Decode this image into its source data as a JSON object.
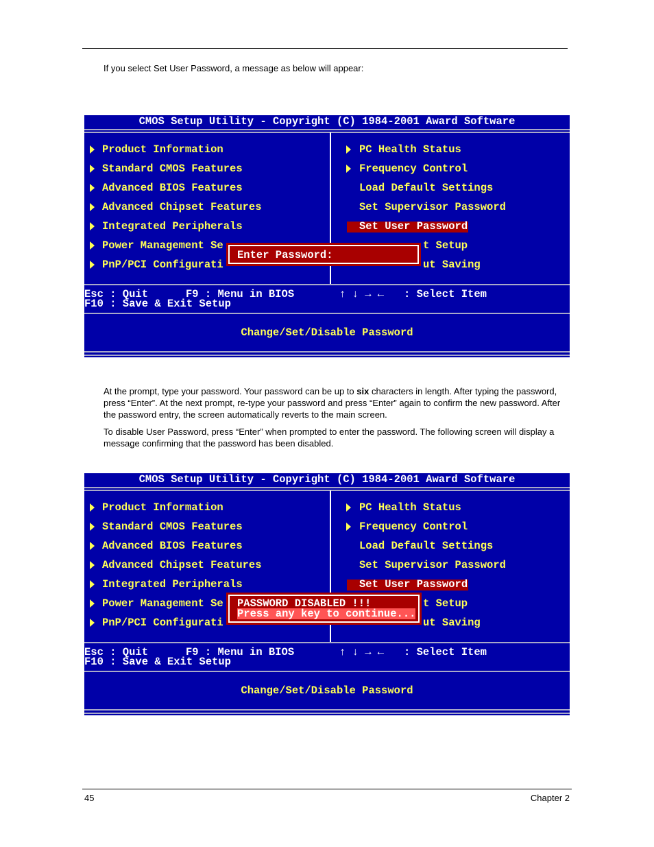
{
  "intro": "If you select Set User Password, a message as below will appear:",
  "para1": [
    "At the prompt, type your password.  Your password can be up to ",
    "six",
    " characters in length.  After typing the password, press “Enter”.  At the next prompt, re-type your password and press “Enter” again to confirm the new password.  After the password entry, the screen automatically reverts to the main screen."
  ],
  "para2": "To disable User Password, press “Enter” when prompted to enter the password.  The following screen will display a message confirming that the password has been disabled.",
  "footer": {
    "page": "45",
    "chapter": "Chapter 2"
  },
  "colors": {
    "background": "#0000a8",
    "menu_text": "#ffff55",
    "highlight": "#a80000",
    "popup": "#a80000"
  },
  "bios": {
    "title": "CMOS Setup Utility - Copyright (C) 1984-2001 Award Software",
    "left_items": [
      {
        "label": "Product Information",
        "icon": "triangle-right-icon"
      },
      {
        "label": "Standard CMOS Features",
        "icon": "triangle-right-icon"
      },
      {
        "label": "Advanced BIOS Features",
        "icon": "triangle-right-icon"
      },
      {
        "label": "Advanced Chipset Features",
        "icon": "triangle-right-icon"
      },
      {
        "label": "Integrated Peripherals",
        "icon": "triangle-right-icon"
      },
      {
        "label": "Power Management Se",
        "icon": "triangle-right-icon"
      },
      {
        "label": "PnP/PCI Configurati",
        "icon": "triangle-right-icon"
      }
    ],
    "right_items": [
      {
        "label": "PC Health Status",
        "arrow": true
      },
      {
        "label": "Frequency Control",
        "arrow": true
      },
      {
        "label": "Load Default Settings",
        "arrow": false
      },
      {
        "label": "Set Supervisor Password",
        "arrow": false
      },
      {
        "label": "Set User Password",
        "arrow": false,
        "selected": true
      },
      {
        "label": "t Setup",
        "arrow": false,
        "partial": true
      },
      {
        "label": "ut Saving",
        "arrow": false,
        "partial": true
      }
    ],
    "keys": {
      "esc": "Esc : Quit",
      "f9": "F9 : Menu in BIOS",
      "arrows": "↑ ↓ → ←",
      "select": ": Select Item",
      "f10": "F10 : Save & Exit Setup"
    },
    "help": "Change/Set/Disable Password"
  },
  "screens": [
    {
      "popup_lines": [
        "Enter Password:"
      ]
    },
    {
      "popup_lines": [
        "PASSWORD DISABLED !!!",
        "Press any key to continue..."
      ]
    }
  ]
}
